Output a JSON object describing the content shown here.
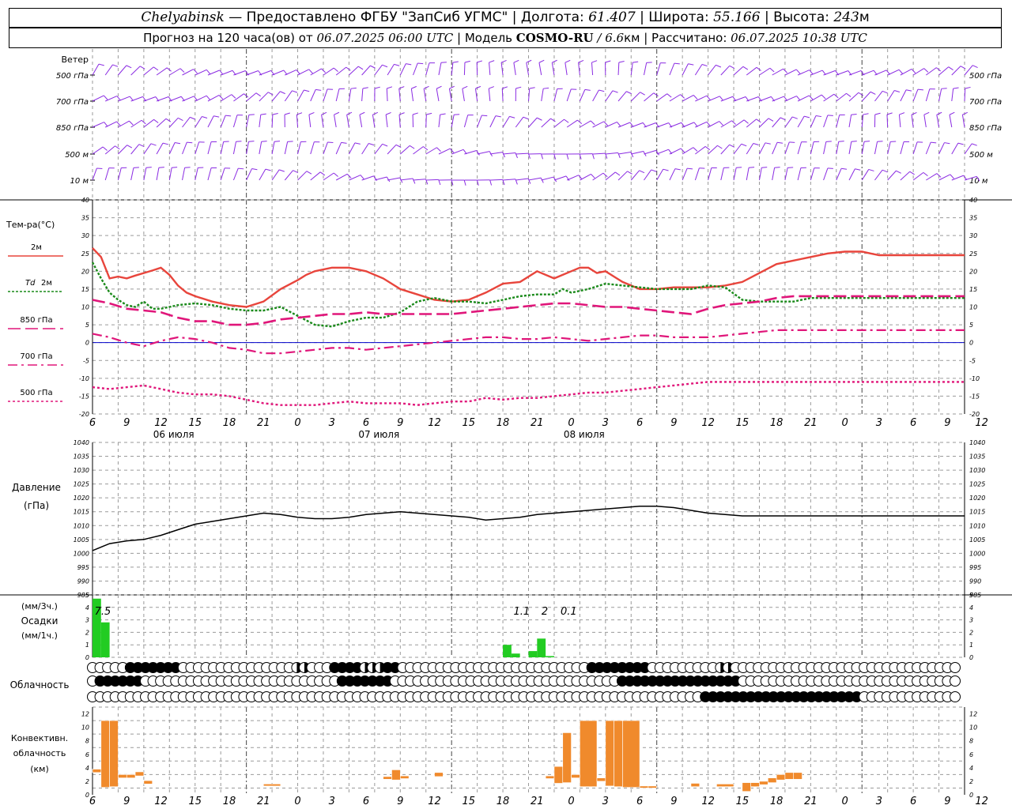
{
  "header": {
    "station": "Chelyabinsk",
    "provider": " — Предоставлено ФГБУ \"ЗапСиб УГМС\" | Долгота: ",
    "lon": "61.407",
    "lat_label": " | Широта: ",
    "lat": "55.166",
    "alt_label": " | Высота: ",
    "alt": "243",
    "alt_unit": "м",
    "forecast_label": "Прогноз на 120 часа(ов) от ",
    "forecast_from": "06.07.2025 06:00 UTC",
    "model_label": "  | Модель ",
    "model": "COSMO-RU",
    "model_sep": " / ",
    "resolution": "6.6",
    "res_unit": "км",
    "calc_label": " | Рассчитано: ",
    "calc_time": "06.07.2025 10:38 UTC"
  },
  "axis": {
    "hour_labels": [
      "6",
      "9",
      "12",
      "15",
      "18",
      "21",
      "0",
      "3",
      "6",
      "9",
      "12",
      "15",
      "18",
      "21",
      "0",
      "3",
      "6",
      "9",
      "12",
      "15",
      "18",
      "21",
      "0",
      "3",
      "6",
      "9",
      "12"
    ],
    "date_labels": [
      {
        "hour": 9.5,
        "text": "06 июля"
      },
      {
        "hour": 33.5,
        "text": "07 июля"
      },
      {
        "hour": 57.5,
        "text": "08 июля"
      }
    ]
  },
  "labels": {
    "wind": "Ветер",
    "wind_levels": [
      "500 гПа",
      "700 гПа",
      "850 гПа",
      "500 м",
      "10  м"
    ],
    "temp": "Тем-ра(°C)",
    "t2m": "2м",
    "td": "Td",
    "td_level": "2м",
    "t850": "850 гПа",
    "t700": "700 гПа",
    "t500": "500 гПа",
    "pressure": "Давление",
    "pressure_unit": "(гПа)",
    "precip_unit3": "(мм/3ч.)",
    "precip": "Осадки",
    "precip_unit1": "(мм/1ч.)",
    "cloud": "Облачность",
    "conv1": "Конвективн.",
    "conv2": "облачность",
    "conv3": "(км)"
  },
  "colors": {
    "t2m": "#e8453c",
    "td": "#1a8a1a",
    "upper": "#e0167a",
    "wind": "#8a2be2",
    "precip": "#22cc22",
    "conv": "#f08a2c",
    "zero": "#0000cc"
  },
  "chart_data": [
    {
      "type": "wind-barbs",
      "levels": [
        "500 гПа",
        "700 гПа",
        "850 гПа",
        "500 м",
        "10  м"
      ]
    },
    {
      "type": "line",
      "ylabel": "Тем-ра(°C)",
      "ylim": [
        -20,
        40
      ],
      "yticks": [
        "40",
        "35",
        "30",
        "25",
        "20",
        "15",
        "10",
        "5",
        "0",
        "-5",
        "-10",
        "-15",
        "-20"
      ],
      "series": [
        {
          "name": "2м",
          "x": [
            0,
            1,
            2,
            3,
            4,
            5,
            6,
            7,
            8,
            9,
            10,
            11,
            12,
            14,
            16,
            18,
            20,
            22,
            24,
            25,
            26,
            28,
            30,
            32,
            34,
            36,
            38,
            40,
            42,
            44,
            46,
            48,
            50,
            52,
            54,
            56,
            57,
            58,
            59,
            60,
            61,
            62,
            63,
            64,
            66,
            68,
            70,
            72,
            74,
            76,
            78,
            80,
            82,
            84,
            86,
            88,
            90,
            91,
            92,
            93,
            94,
            95,
            96,
            97,
            98,
            99,
            100,
            101,
            102
          ],
          "values": [
            26.5,
            24,
            18,
            18.5,
            18,
            18.8,
            19.5,
            20.2,
            21,
            19,
            16,
            14,
            13,
            11.5,
            10.5,
            10,
            11.5,
            15,
            17.5,
            19,
            20,
            21,
            21,
            20,
            18,
            15,
            13.5,
            12,
            11.5,
            12,
            14,
            16.5,
            17,
            20,
            18,
            20,
            21,
            21,
            19.5,
            20,
            18.5,
            17,
            16,
            15,
            15,
            15.5,
            15.5,
            15.5,
            16,
            17,
            19.5,
            22,
            23,
            24,
            25,
            25.5,
            25.5,
            25,
            24.5,
            24.5,
            24.5,
            24.5,
            24.5,
            24.5,
            24.5,
            24.5,
            24.5,
            24.5,
            24.5
          ]
        },
        {
          "name": "Td 2м",
          "x": [
            0,
            1,
            2,
            3,
            4,
            5,
            6,
            7,
            8,
            9,
            10,
            12,
            14,
            16,
            18,
            20,
            22,
            24,
            26,
            28,
            30,
            32,
            34,
            36,
            38,
            40,
            42,
            44,
            46,
            48,
            50,
            52,
            54,
            55,
            56,
            58,
            60,
            62,
            64,
            66,
            68,
            70,
            72,
            74,
            76,
            78,
            80,
            82,
            84,
            86,
            88,
            90,
            92,
            94,
            96,
            98,
            100,
            102
          ],
          "values": [
            22.5,
            18,
            14,
            12,
            10.5,
            10,
            11.5,
            9.5,
            9.5,
            10,
            10.5,
            11,
            10.5,
            9.5,
            9,
            9,
            10,
            7.5,
            5,
            4.5,
            6,
            7,
            7,
            8.5,
            11.5,
            12.5,
            11.5,
            11.5,
            11,
            12,
            13,
            13.5,
            13.5,
            15,
            14,
            15,
            16.5,
            16,
            15.5,
            15,
            15,
            15,
            16,
            15.5,
            12,
            11.5,
            11.5,
            11.5,
            12.5,
            12.5,
            12.5,
            12.5,
            12.5,
            12.5,
            12.5,
            12.5,
            12.5,
            12.5
          ]
        },
        {
          "name": "850 гПа",
          "x": [
            0,
            2,
            4,
            6,
            8,
            10,
            12,
            14,
            16,
            18,
            20,
            22,
            24,
            26,
            28,
            30,
            32,
            34,
            36,
            38,
            40,
            42,
            44,
            46,
            48,
            50,
            52,
            54,
            56,
            58,
            60,
            62,
            64,
            66,
            68,
            70,
            72,
            74,
            76,
            78,
            80,
            82,
            84,
            86,
            88,
            90,
            92,
            94,
            96,
            98,
            100,
            102
          ],
          "values": [
            12,
            11,
            9.5,
            9,
            8.5,
            7,
            6,
            6,
            5,
            5,
            5.5,
            6.5,
            7,
            7.5,
            8,
            8,
            8.5,
            8,
            8,
            8,
            8,
            8,
            8.5,
            9,
            9.5,
            10,
            10.5,
            11,
            11,
            10.5,
            10,
            10,
            9.5,
            9,
            8.5,
            8,
            9.5,
            10.5,
            11,
            11.5,
            12.5,
            13,
            13,
            13,
            13,
            13,
            13,
            13,
            13,
            13,
            13,
            13
          ]
        },
        {
          "name": "700 гПа",
          "x": [
            0,
            2,
            4,
            6,
            8,
            10,
            12,
            14,
            16,
            18,
            20,
            22,
            24,
            26,
            28,
            30,
            32,
            34,
            36,
            38,
            40,
            42,
            44,
            46,
            48,
            50,
            52,
            54,
            56,
            58,
            60,
            62,
            64,
            66,
            68,
            70,
            72,
            74,
            76,
            78,
            80,
            82,
            84,
            86,
            88,
            90,
            92,
            94,
            96,
            98,
            100,
            102
          ],
          "values": [
            2.5,
            1.5,
            0,
            -1,
            0.5,
            1.5,
            1,
            0,
            -1.5,
            -2,
            -3,
            -3,
            -2.5,
            -2,
            -1.5,
            -1.5,
            -2,
            -1.5,
            -1,
            -0.5,
            0,
            0.5,
            1,
            1.5,
            1.5,
            1,
            1,
            1.5,
            1,
            0.5,
            1,
            1.5,
            2,
            2,
            1.5,
            1.5,
            1.5,
            2,
            2.5,
            3,
            3.5,
            3.5,
            3.5,
            3.5,
            3.5,
            3.5,
            3.5,
            3.5,
            3.5,
            3.5,
            3.5,
            3.5
          ]
        },
        {
          "name": "500 гПа",
          "x": [
            0,
            2,
            4,
            6,
            8,
            10,
            12,
            14,
            16,
            18,
            20,
            22,
            24,
            26,
            28,
            30,
            32,
            34,
            36,
            38,
            40,
            42,
            44,
            46,
            48,
            50,
            52,
            54,
            56,
            58,
            60,
            62,
            64,
            66,
            68,
            70,
            72,
            74,
            76,
            78,
            80,
            82,
            84,
            86,
            88,
            90,
            92,
            94,
            96,
            98,
            100,
            102
          ],
          "values": [
            -12.5,
            -13,
            -12.5,
            -12,
            -13,
            -14,
            -14.5,
            -14.5,
            -15,
            -16,
            -17,
            -17.5,
            -17.5,
            -17.5,
            -17,
            -16.5,
            -17,
            -17,
            -17,
            -17.5,
            -17,
            -16.5,
            -16.5,
            -15.5,
            -16,
            -15.5,
            -15.5,
            -15,
            -14.5,
            -14,
            -14,
            -13.5,
            -13,
            -12.5,
            -12,
            -11.5,
            -11,
            -11,
            -11,
            -11,
            -11,
            -11,
            -11,
            -11,
            -11,
            -11,
            -11,
            -11,
            -11,
            -11,
            -11,
            -11
          ]
        }
      ]
    },
    {
      "type": "line",
      "ylabel": "Давление",
      "ylim": [
        985,
        1040
      ],
      "yticks": [
        "1040",
        "1035",
        "1030",
        "1025",
        "1020",
        "1015",
        "1010",
        "1005",
        "1000",
        "995",
        "990",
        "985"
      ],
      "series": [
        {
          "name": "pressure",
          "x": [
            0,
            2,
            4,
            6,
            8,
            10,
            12,
            14,
            16,
            18,
            20,
            22,
            24,
            26,
            28,
            30,
            32,
            34,
            36,
            38,
            40,
            42,
            44,
            46,
            48,
            50,
            52,
            54,
            56,
            58,
            60,
            62,
            64,
            66,
            68,
            70,
            72,
            74,
            76,
            78,
            80,
            82,
            84,
            86,
            88,
            90,
            92,
            94,
            96,
            98,
            100,
            102
          ],
          "values": [
            1001,
            1003.5,
            1004.5,
            1005,
            1006.5,
            1008.5,
            1010.5,
            1011.5,
            1012.5,
            1013.5,
            1014.5,
            1014,
            1013,
            1012.5,
            1012.5,
            1013,
            1014,
            1014.5,
            1015,
            1014.5,
            1014,
            1013.5,
            1013,
            1012,
            1012.5,
            1013,
            1014,
            1014.5,
            1015,
            1015.5,
            1016,
            1016.5,
            1017,
            1017,
            1016.5,
            1015.5,
            1014.5,
            1014,
            1013.5,
            1013.5,
            1013.5,
            1013.5,
            1013.5,
            1013.5,
            1013.5,
            1013.5,
            1013.5,
            1013.5,
            1013.5,
            1013.5,
            1013.5,
            1013.5
          ]
        }
      ]
    },
    {
      "type": "bar",
      "ylabel": "Осадки",
      "ylim": [
        0,
        5
      ],
      "yticks": [
        "5",
        "4",
        "3",
        "2",
        "1",
        "0"
      ],
      "bars": [
        {
          "start": 0,
          "end": 1,
          "value": 4.7
        },
        {
          "start": 1,
          "end": 2,
          "value": 2.8
        },
        {
          "start": 48,
          "end": 49,
          "value": 1
        },
        {
          "start": 49,
          "end": 50,
          "value": 0.3
        },
        {
          "start": 51,
          "end": 52,
          "value": 0.5
        },
        {
          "start": 52,
          "end": 53,
          "value": 1.5
        },
        {
          "start": 53,
          "end": 54,
          "value": 0.1
        }
      ],
      "annotations": [
        {
          "hour": 1.2,
          "text": "7.5"
        },
        {
          "hour": 50.2,
          "text": "1.1"
        },
        {
          "hour": 52.9,
          "text": "2"
        },
        {
          "hour": 55.7,
          "text": "0.1"
        }
      ]
    },
    {
      "type": "bar",
      "ylabel": "Конвективн. облачность (км)",
      "ylim": [
        0,
        13
      ],
      "yticks": [
        "12",
        "10",
        "8",
        "6",
        "4",
        "2",
        "0"
      ],
      "bars": [
        {
          "start": 0,
          "end": 1,
          "bottom": 3.3,
          "top": 3.8
        },
        {
          "start": 1,
          "end": 2,
          "bottom": 1.1,
          "top": 11
        },
        {
          "start": 2,
          "end": 3,
          "bottom": 1.2,
          "top": 11
        },
        {
          "start": 3,
          "end": 4,
          "bottom": 2.5,
          "top": 3
        },
        {
          "start": 4,
          "end": 5,
          "bottom": 2.5,
          "top": 3
        },
        {
          "start": 5,
          "end": 6,
          "bottom": 2.8,
          "top": 3.4
        },
        {
          "start": 6,
          "end": 7,
          "bottom": 1.6,
          "top": 2.1
        },
        {
          "start": 20,
          "end": 22,
          "bottom": 1.3,
          "top": 1.6
        },
        {
          "start": 34,
          "end": 35,
          "bottom": 2.3,
          "top": 2.7
        },
        {
          "start": 35,
          "end": 36,
          "bottom": 2.2,
          "top": 3.7
        },
        {
          "start": 36,
          "end": 37,
          "bottom": 2.4,
          "top": 2.8
        },
        {
          "start": 40,
          "end": 41,
          "bottom": 2.7,
          "top": 3.3
        },
        {
          "start": 53,
          "end": 54,
          "bottom": 2.4,
          "top": 2.8
        },
        {
          "start": 54,
          "end": 55,
          "bottom": 1.7,
          "top": 4.2
        },
        {
          "start": 55,
          "end": 56,
          "bottom": 1.8,
          "top": 9.2
        },
        {
          "start": 56,
          "end": 57,
          "bottom": 2.5,
          "top": 3
        },
        {
          "start": 57,
          "end": 59,
          "bottom": 1.2,
          "top": 11
        },
        {
          "start": 59,
          "end": 60,
          "bottom": 2,
          "top": 2.5
        },
        {
          "start": 60,
          "end": 61,
          "bottom": 1.3,
          "top": 11
        },
        {
          "start": 61,
          "end": 62,
          "bottom": 1.2,
          "top": 11
        },
        {
          "start": 62,
          "end": 64,
          "bottom": 1.1,
          "top": 11
        },
        {
          "start": 64,
          "end": 65,
          "bottom": 1,
          "top": 1.3
        },
        {
          "start": 65,
          "end": 66,
          "bottom": 1,
          "top": 1.3
        },
        {
          "start": 70,
          "end": 71,
          "bottom": 1.2,
          "top": 1.7
        },
        {
          "start": 73,
          "end": 75,
          "bottom": 1.2,
          "top": 1.6
        },
        {
          "start": 76,
          "end": 77,
          "bottom": 0.5,
          "top": 1.8
        },
        {
          "start": 77,
          "end": 78,
          "bottom": 1.2,
          "top": 1.8
        },
        {
          "start": 78,
          "end": 79,
          "bottom": 1.5,
          "top": 2
        },
        {
          "start": 79,
          "end": 80,
          "bottom": 1.8,
          "top": 2.5
        },
        {
          "start": 80,
          "end": 81,
          "bottom": 2.2,
          "top": 3
        },
        {
          "start": 81,
          "end": 82,
          "bottom": 2.3,
          "top": 3.3
        },
        {
          "start": 82,
          "end": 83,
          "bottom": 2.3,
          "top": 3.3
        }
      ]
    },
    {
      "type": "cloud-cover",
      "rows": [
        "0000011111110000000000000002200011112221100000000000000000000000001111111100000000022000000000000000000000000000000",
        "0111111000000000000000000000000001111111000000000000000000000000000000111111111111111100000000000000000000000000000",
        "0000000000000000000000000000000000000000000000000000000000000000000000000000000001111111111111111111110000000000000"
      ]
    }
  ]
}
